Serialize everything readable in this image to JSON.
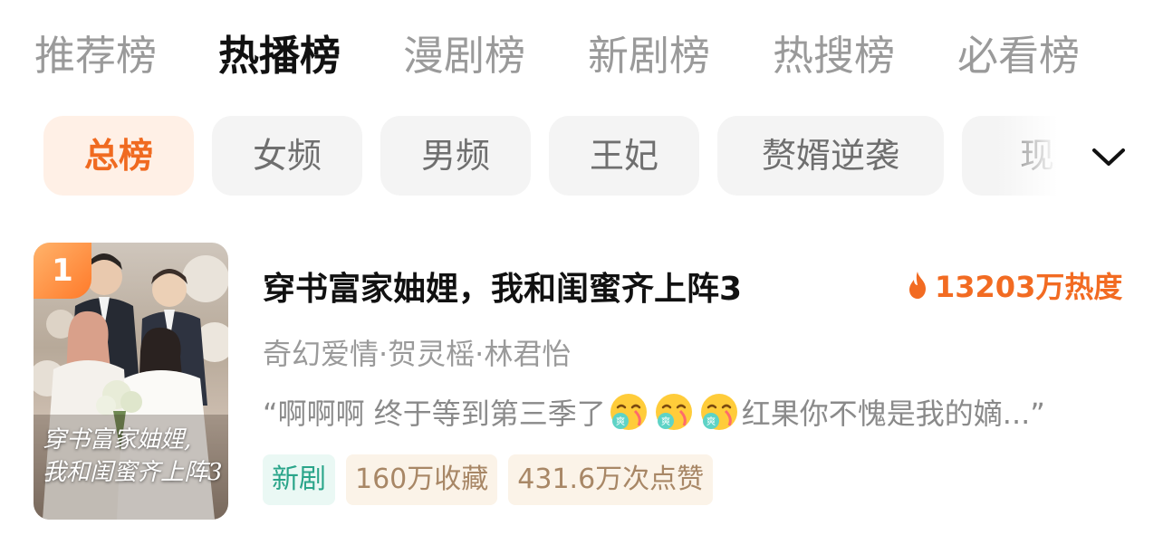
{
  "top_tabs": [
    {
      "label": "推荐榜",
      "active": false
    },
    {
      "label": "热播榜",
      "active": true
    },
    {
      "label": "漫剧榜",
      "active": false
    },
    {
      "label": "新剧榜",
      "active": false
    },
    {
      "label": "热搜榜",
      "active": false
    },
    {
      "label": "必看榜",
      "active": false
    }
  ],
  "chips": [
    {
      "label": "总榜",
      "active": true
    },
    {
      "label": "女频",
      "active": false
    },
    {
      "label": "男频",
      "active": false
    },
    {
      "label": "王妃",
      "active": false
    },
    {
      "label": "赘婿逆袭",
      "active": false
    },
    {
      "label": "现",
      "active": false
    }
  ],
  "expand_icon": "chevron-down-icon",
  "item": {
    "rank": "1",
    "poster_title_line1": "穿书富家妯娌,",
    "poster_title_line2": "我和闺蜜齐上阵3",
    "title": "穿书富家妯娌，我和闺蜜齐上阵3",
    "heat_icon": "flame-icon",
    "heat": "13203万热度",
    "meta": "奇幻爱情·贺灵榣·林君怡",
    "comment_prefix": "“啊啊啊 终于等到第三季了",
    "comment_emoji": "爽",
    "comment_suffix": "红果你不愧是我的嫡...”",
    "tags": [
      {
        "label": "新剧",
        "style": "green"
      },
      {
        "label": "160万收藏",
        "style": "beige"
      },
      {
        "label": "431.6万次点赞",
        "style": "beige"
      }
    ]
  },
  "colors": {
    "accent": "#f06a20",
    "tab_inactive": "#9a9a9a",
    "tag_green": "#2aa58a"
  }
}
